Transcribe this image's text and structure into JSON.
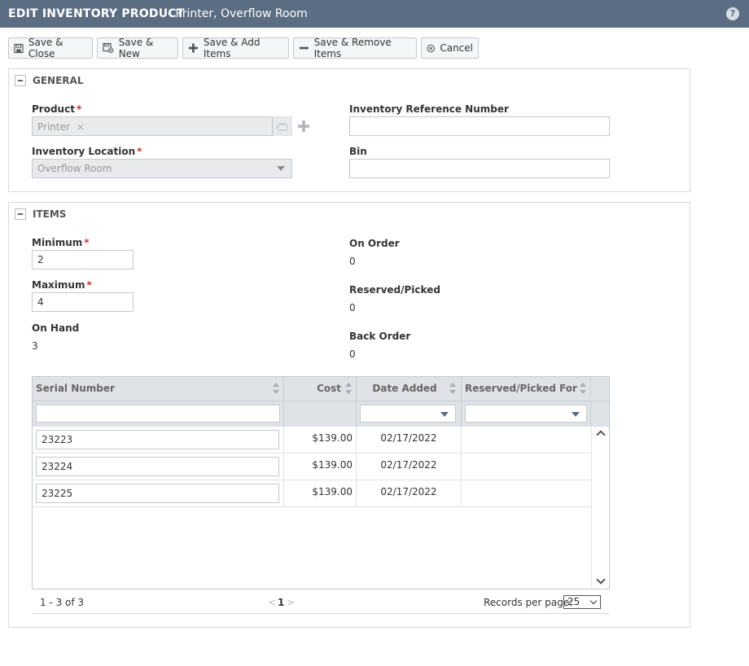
{
  "window": {
    "title": "EDIT INVENTORY PRODUCT",
    "subtitle": "- Printer, Overflow Room",
    "help_label": "?"
  },
  "toolbar": {
    "save_close": "Save & Close",
    "save_new": "Save & New",
    "save_add_items": "Save & Add Items",
    "save_remove_items": "Save & Remove Items",
    "cancel": "Cancel"
  },
  "general": {
    "heading": "GENERAL",
    "product_label": "Product",
    "product_value": "Printer",
    "product_remove": "×",
    "location_label": "Inventory Location",
    "location_value": "Overflow Room",
    "ref_label": "Inventory Reference Number",
    "ref_value": "",
    "bin_label": "Bin",
    "bin_value": ""
  },
  "items": {
    "heading": "ITEMS",
    "minimum_label": "Minimum",
    "minimum_value": "2",
    "maximum_label": "Maximum",
    "maximum_value": "4",
    "on_hand_label": "On Hand",
    "on_hand_value": "3",
    "on_order_label": "On Order",
    "on_order_value": "0",
    "reserved_label": "Reserved/Picked",
    "reserved_value": "0",
    "back_order_label": "Back Order",
    "back_order_value": "0",
    "required_mark": "*"
  },
  "grid": {
    "columns": [
      "Serial Number",
      "Cost",
      "Date Added",
      "Reserved/Picked For"
    ],
    "rows": [
      {
        "serial": "23223",
        "cost": "$139.00",
        "date": "02/17/2022",
        "reserved_for": ""
      },
      {
        "serial": "23224",
        "cost": "$139.00",
        "date": "02/17/2022",
        "reserved_for": ""
      },
      {
        "serial": "23225",
        "cost": "$139.00",
        "date": "02/17/2022",
        "reserved_for": ""
      }
    ]
  },
  "pager": {
    "summary": "1 - 3 of 3",
    "prev": "<",
    "current_page": "1",
    "next": ">",
    "rpp_label": "Records per page:",
    "rpp_value": "25"
  },
  "colors": {
    "titlebar": "#5a6d82",
    "required": "#c0392b",
    "header_bg": "#dfe2e6"
  }
}
